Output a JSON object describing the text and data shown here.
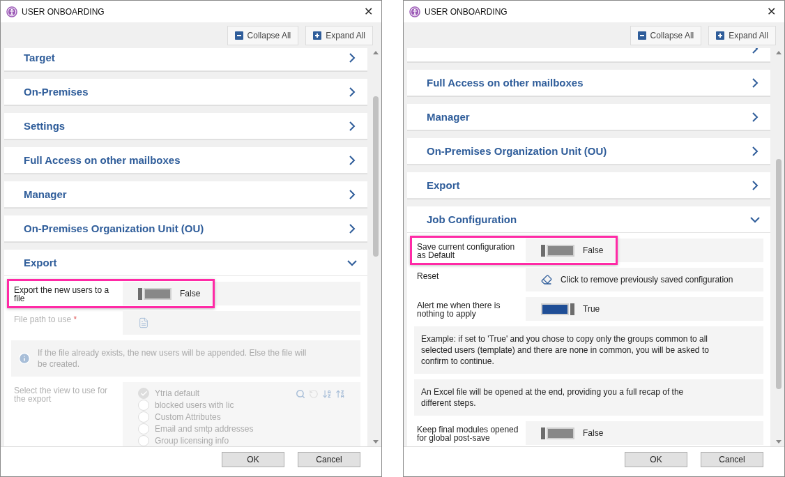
{
  "dialogs": [
    {
      "title": "USER ONBOARDING",
      "close": "✕",
      "toolbar": [
        {
          "kind": "collapse",
          "label": "Collapse All"
        },
        {
          "kind": "expand",
          "label": "Expand All"
        }
      ],
      "sections": [
        {
          "title": "Target",
          "expanded": false
        },
        {
          "title": "On-Premises",
          "expanded": false
        },
        {
          "title": "Settings",
          "expanded": false
        },
        {
          "title": "Full Access on other mailboxes",
          "expanded": false
        },
        {
          "title": "Manager",
          "expanded": false
        },
        {
          "title": "On-Premises Organization Unit (OU)",
          "expanded": false
        },
        {
          "title": "Export",
          "expanded": true,
          "fields": [
            {
              "kind": "toggle",
              "label": "Export the new users to a file",
              "on": false,
              "value": "False",
              "highlighted": true
            },
            {
              "kind": "file",
              "label": "File path to use",
              "required": "*",
              "disabled": true
            },
            {
              "kind": "info",
              "text": "If the file already exists, the new users will be appended. Else the file will be created.",
              "disabled": true
            },
            {
              "kind": "views",
              "label": "Select the view to use for the export",
              "disabled": true,
              "options": [
                {
                  "label": "Ytria default",
                  "selected": true
                },
                {
                  "label": "blocked users with lic",
                  "selected": false
                },
                {
                  "label": "Custom Attributes",
                  "selected": false
                },
                {
                  "label": "Email and smtp addresses",
                  "selected": false
                },
                {
                  "label": "Group licensing info",
                  "selected": false
                }
              ]
            }
          ]
        }
      ],
      "buttons": [
        "OK",
        "Cancel"
      ]
    },
    {
      "title": "USER ONBOARDING",
      "close": "✕",
      "toolbar": [
        {
          "kind": "collapse",
          "label": "Collapse All"
        },
        {
          "kind": "expand",
          "label": "Expand All"
        }
      ],
      "sections": [
        {
          "expanded": false
        },
        {
          "title": "Full Access on other mailboxes",
          "expanded": false
        },
        {
          "title": "Manager",
          "expanded": false
        },
        {
          "title": "On-Premises Organization Unit (OU)",
          "expanded": false
        },
        {
          "title": "Export",
          "expanded": false
        },
        {
          "title": "Job Configuration",
          "expanded": true,
          "fields": [
            {
              "kind": "toggle",
              "label": "Save current configuration as Default",
              "on": false,
              "value": "False",
              "highlighted": true
            },
            {
              "kind": "action",
              "label": "Reset",
              "text": "Click to remove previously saved configuration"
            },
            {
              "kind": "toggle",
              "label": "Alert me when there is nothing to apply",
              "on": true,
              "value": "True",
              "highlighted": false
            },
            {
              "kind": "note",
              "text": "Example: if set to 'True' and you chose to copy only the groups common to all selected users (template) and there are none in common, you will be asked to confirm to continue."
            },
            {
              "kind": "note",
              "text": "An Excel file will be opened at the end, providing you a full recap of the different steps."
            },
            {
              "kind": "toggle",
              "label": "Keep final modules opened for global post-save",
              "on": false,
              "value": "False",
              "highlighted": false
            }
          ]
        }
      ],
      "buttons": [
        "OK",
        "Cancel"
      ]
    }
  ]
}
